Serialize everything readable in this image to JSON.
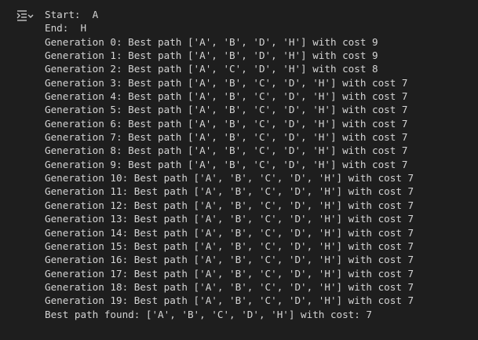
{
  "toolbar": {
    "output_menu_icon": "output-collapse-icon"
  },
  "output": {
    "lines": [
      "Start:  A",
      "End:  H",
      "Generation 0: Best path ['A', 'B', 'D', 'H'] with cost 9",
      "Generation 1: Best path ['A', 'B', 'D', 'H'] with cost 9",
      "Generation 2: Best path ['A', 'C', 'D', 'H'] with cost 8",
      "Generation 3: Best path ['A', 'B', 'C', 'D', 'H'] with cost 7",
      "Generation 4: Best path ['A', 'B', 'C', 'D', 'H'] with cost 7",
      "Generation 5: Best path ['A', 'B', 'C', 'D', 'H'] with cost 7",
      "Generation 6: Best path ['A', 'B', 'C', 'D', 'H'] with cost 7",
      "Generation 7: Best path ['A', 'B', 'C', 'D', 'H'] with cost 7",
      "Generation 8: Best path ['A', 'B', 'C', 'D', 'H'] with cost 7",
      "Generation 9: Best path ['A', 'B', 'C', 'D', 'H'] with cost 7",
      "Generation 10: Best path ['A', 'B', 'C', 'D', 'H'] with cost 7",
      "Generation 11: Best path ['A', 'B', 'C', 'D', 'H'] with cost 7",
      "Generation 12: Best path ['A', 'B', 'C', 'D', 'H'] with cost 7",
      "Generation 13: Best path ['A', 'B', 'C', 'D', 'H'] with cost 7",
      "Generation 14: Best path ['A', 'B', 'C', 'D', 'H'] with cost 7",
      "Generation 15: Best path ['A', 'B', 'C', 'D', 'H'] with cost 7",
      "Generation 16: Best path ['A', 'B', 'C', 'D', 'H'] with cost 7",
      "Generation 17: Best path ['A', 'B', 'C', 'D', 'H'] with cost 7",
      "Generation 18: Best path ['A', 'B', 'C', 'D', 'H'] with cost 7",
      "Generation 19: Best path ['A', 'B', 'C', 'D', 'H'] with cost 7",
      "Best path found: ['A', 'B', 'C', 'D', 'H'] with cost: 7"
    ]
  },
  "colors": {
    "background": "#1e1e1e",
    "text": "#d4d4d4",
    "icon": "#c5c5c5"
  }
}
